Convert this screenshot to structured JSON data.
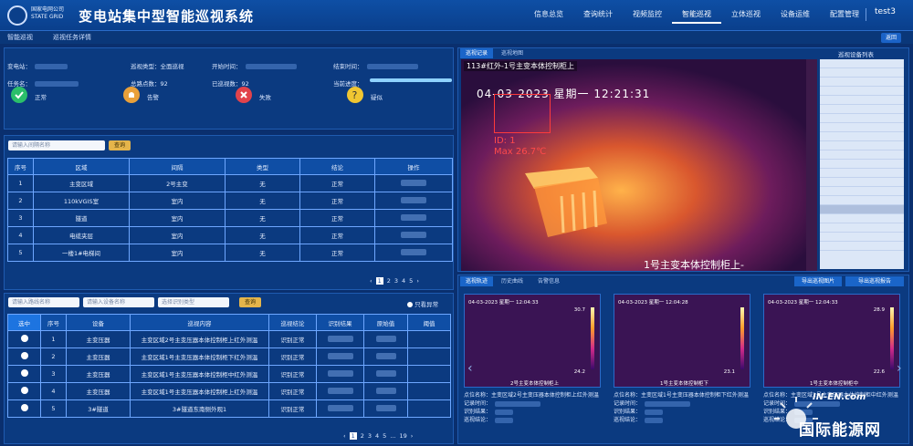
{
  "header": {
    "logo_lines": [
      "国家电网公司",
      "STATE GRID"
    ],
    "title": "变电站集中型智能巡视系统",
    "nav": [
      "信息总览",
      "查询统计",
      "视频监控",
      "智能巡视",
      "立体巡视",
      "设备运维",
      "配置管理"
    ],
    "active_nav": "智能巡视",
    "user": "test3"
  },
  "subnav": {
    "items": [
      "智能巡视",
      "巡视任务详情"
    ],
    "back_label": "返回"
  },
  "task_info": {
    "station_label": "变电站：",
    "type_label": "巡视类型：",
    "type_value": "全面巡视",
    "start_label": "开始时间：",
    "end_label": "结束时间：",
    "name_label": "任务名：",
    "total_label": "总路点数：",
    "total_value": "92",
    "done_label": "已巡视数：",
    "done_value": "92",
    "progress_label": "当前进度：",
    "progress_fraction": 1.0
  },
  "stats": [
    {
      "label": "正常",
      "icon": "check-icon",
      "color": "#2bbf6a"
    },
    {
      "label": "告警",
      "icon": "bell-icon",
      "color": "#e9a03a"
    },
    {
      "label": "失败",
      "icon": "x-icon",
      "color": "#e2434b"
    },
    {
      "label": "疑似",
      "icon": "question-icon",
      "color": "#f0c632"
    }
  ],
  "interval_search": {
    "placeholder": "请输入间隔名称",
    "button": "查询"
  },
  "interval_table": {
    "headers": [
      "序号",
      "区域",
      "间隔",
      "类型",
      "结论",
      "操作"
    ],
    "rows": [
      [
        "1",
        "主变区域",
        "2号主变",
        "无",
        "正常"
      ],
      [
        "2",
        "110kVGIS室",
        "室内",
        "无",
        "正常"
      ],
      [
        "3",
        "隧道",
        "室内",
        "无",
        "正常"
      ],
      [
        "4",
        "电缆夹层",
        "室内",
        "无",
        "正常"
      ],
      [
        "5",
        "一楼1#电梯间",
        "室内",
        "无",
        "正常"
      ]
    ],
    "pages": [
      "1",
      "2",
      "3",
      "4",
      "5"
    ],
    "current_page": "1"
  },
  "point_search": {
    "placeholder1": "请输入路线名称",
    "placeholder2": "请输入设备名称",
    "placeholder3": "选择识别类型",
    "button": "查询",
    "abnormal_label": "只看异常"
  },
  "point_table": {
    "headers": [
      "选中",
      "序号",
      "设备",
      "巡视内容",
      "巡视结论",
      "识别结果",
      "原始值",
      "阈值"
    ],
    "rows": [
      [
        "1",
        "主变压器",
        "主变区域2号主变压器本体控制柜上红外测温",
        "识别正常"
      ],
      [
        "2",
        "主变压器",
        "主变区域1号主变压器本体控制柜下红外测温",
        "识别正常"
      ],
      [
        "3",
        "主变压器",
        "主变区域1号主变压器本体控制柜中红外测温",
        "识别正常"
      ],
      [
        "4",
        "主变压器",
        "主变区域1号主变压器本体控制柜上红外测温",
        "识别正常"
      ],
      [
        "5",
        "3#隧道",
        "3#隧道东南侧外观1",
        "识别正常"
      ]
    ],
    "pages": [
      "1",
      "2",
      "3",
      "4",
      "5",
      "...",
      "19"
    ],
    "current_page": "1"
  },
  "video": {
    "tabs": [
      "巡视记录",
      "巡视地图"
    ],
    "title": "113#红外-1号主变本体控制柜上",
    "timestamp": "04-03-2023  星期一  12:21:31",
    "roi_id": "ID: 1",
    "roi_max": "Max  26.7℃",
    "object_name": "1号主变本体控制柜上-",
    "device_list_title": "巡视设备列表"
  },
  "history": {
    "tabs": [
      "巡视轨迹",
      "历史曲线",
      "告警信息"
    ],
    "export_image": "导出巡视图片",
    "export_report": "导出巡视报告",
    "thumbs": [
      {
        "time": "04-03-2023 星期一 12:04:33",
        "max": "30.7",
        "min": "24.2",
        "name": "2号主变本体控制柜上",
        "point_label": "点位名称：",
        "point": "主变区域2号主变压器本体控制柜上红外测温",
        "rec_label": "记录时间：",
        "res_label": "识别结果：",
        "cond_label": "巡视结论："
      },
      {
        "time": "04-03-2023 星期一 12:04:28",
        "max": "",
        "min": "23.1",
        "name": "1号主变本体控制柜下",
        "point_label": "点位名称：",
        "point": "主变区域1号主变压器本体控制柜下红外测温",
        "rec_label": "记录时间：",
        "res_label": "识别结果：",
        "cond_label": "巡视结论："
      },
      {
        "time": "04-03-2023 星期一 12:04:33",
        "max": "28.9",
        "min": "22.6",
        "name": "1号主变本体控制柜中",
        "point_label": "点位名称：",
        "point": "主变区域1号主变压器本体控制柜中红外测温",
        "rec_label": "记录时间：",
        "res_label": "识别结果：",
        "cond_label": "巡视结论："
      }
    ]
  },
  "watermark": {
    "top": "IN-EN.com",
    "bottom": "国际能源网"
  }
}
